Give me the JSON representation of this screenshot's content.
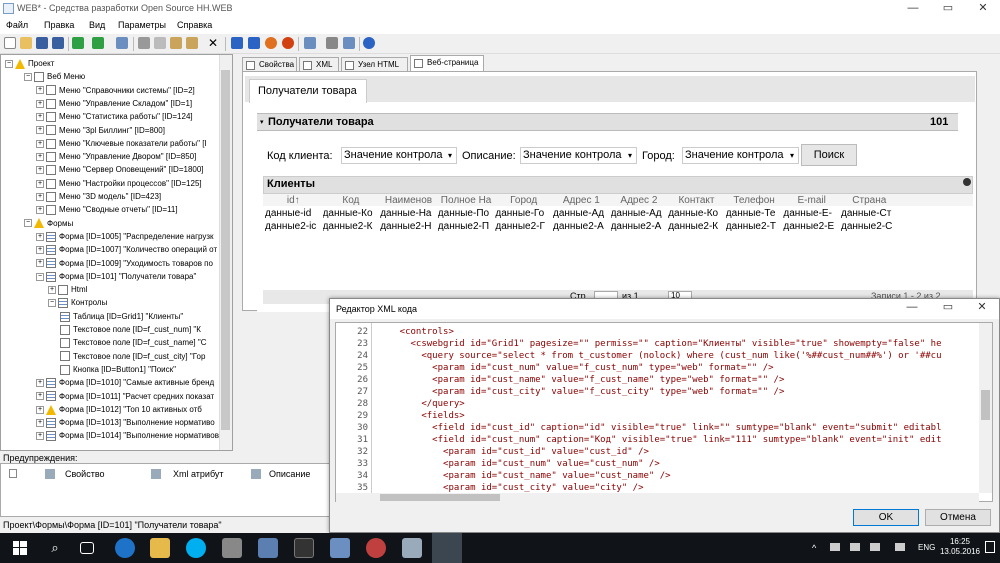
{
  "window": {
    "title": "WEB* - Средства разработки Open Source HH.WEB",
    "min": "—",
    "max": "▭",
    "close": "✕"
  },
  "menu": [
    "Файл",
    "Правка",
    "Вид",
    "Параметры",
    "Справка"
  ],
  "tree": [
    {
      "label": "Проект",
      "level": 0,
      "icon": "warn"
    },
    {
      "label": "Веб Меню",
      "level": 1,
      "icon": "folder"
    },
    {
      "label": "Меню \"Справочники системы\" [ID=2]",
      "level": 2,
      "icon": "menu"
    },
    {
      "label": "Меню \"Управление Складом\" [ID=1]",
      "level": 2,
      "icon": "menu"
    },
    {
      "label": "Меню \"Статистика работы\" [ID=124]",
      "level": 2,
      "icon": "menu"
    },
    {
      "label": "Меню \"3pl Биллинг\" [ID=800]",
      "level": 2,
      "icon": "menu"
    },
    {
      "label": "Меню \"Ключевые показатели работы\" [I",
      "level": 2,
      "icon": "menu"
    },
    {
      "label": "Меню \"Управление Двором\" [ID=850]",
      "level": 2,
      "icon": "menu"
    },
    {
      "label": "Меню \"Сервер Оповещений\" [ID=1800]",
      "level": 2,
      "icon": "menu"
    },
    {
      "label": "Меню \"Настройки процессов\" [ID=125]",
      "level": 2,
      "icon": "menu"
    },
    {
      "label": "Меню \"3D модель\" [ID=423]",
      "level": 2,
      "icon": "menu"
    },
    {
      "label": "Меню \"Сводные отчеты\" [ID=11]",
      "level": 2,
      "icon": "menu"
    },
    {
      "label": "Формы",
      "level": 1,
      "icon": "warn"
    },
    {
      "label": "Форма [ID=1005] \"Распределение нагрузк",
      "level": 2,
      "icon": "grid"
    },
    {
      "label": "Форма [ID=1007] \"Количество операций от",
      "level": 2,
      "icon": "grid"
    },
    {
      "label": "Форма [ID=1009] \"Уходимость товаров по",
      "level": 2,
      "icon": "grid"
    },
    {
      "label": "Форма [ID=101] \"Получатели товара\"",
      "level": 2,
      "icon": "grid"
    },
    {
      "label": "Html",
      "level": 3,
      "icon": "doc"
    },
    {
      "label": "Контролы",
      "level": 3,
      "icon": "grid"
    },
    {
      "label": "Таблица [ID=Grid1] \"Клиенты\"",
      "level": 4,
      "icon": "grid"
    },
    {
      "label": "Текстовое поле [ID=f_cust_num] \"К",
      "level": 4,
      "icon": "txt"
    },
    {
      "label": "Текстовое поле [ID=f_cust_name] \"С",
      "level": 4,
      "icon": "txt"
    },
    {
      "label": "Текстовое поле [ID=f_cust_city] \"Гор",
      "level": 4,
      "icon": "txt"
    },
    {
      "label": "Кнопка [ID=Button1] \"Поиск\"",
      "level": 4,
      "icon": "txt"
    },
    {
      "label": "Форма [ID=1010] \"Самые активные бренд",
      "level": 2,
      "icon": "grid"
    },
    {
      "label": "Форма [ID=1011] \"Расчет средних показат",
      "level": 2,
      "icon": "grid"
    },
    {
      "label": "Форма [ID=1012] \"Топ 10 активных отб",
      "level": 2,
      "icon": "warn"
    },
    {
      "label": "Форма [ID=1013] \"Выполнение нормативо",
      "level": 2,
      "icon": "grid"
    },
    {
      "label": "Форма [ID=1014] \"Выполнение нормативов",
      "level": 2,
      "icon": "grid"
    }
  ],
  "tabs": [
    "Свойства",
    "XML",
    "Узел HTML",
    "Веб-страница"
  ],
  "page_tab": "Получатели товара",
  "panel": {
    "title": "Получатели товара",
    "count": "101"
  },
  "filters": {
    "code_label": "Код клиента:",
    "code_value": "Значение контрола",
    "desc_label": "Описание:",
    "desc_value": "Значение контрола",
    "city_label": "Город:",
    "city_value": "Значение контрола",
    "search": "Поиск"
  },
  "grid": {
    "title": "Клиенты",
    "columns": [
      "id↑",
      "Код",
      "Наименов",
      "Полное На",
      "Город",
      "Адрес 1",
      "Адрес 2",
      "Контакт",
      "Телефон",
      "E-mail",
      "Страна"
    ],
    "rows": [
      [
        "данные-id",
        "данные-Ко",
        "данные-На",
        "данные-По",
        "данные-Го",
        "данные-Ад",
        "данные-Ад",
        "данные-Ко",
        "данные-Те",
        "данные-Е-",
        "данные-Ст"
      ],
      [
        "данные2-ic",
        "данные2-К",
        "данные2-Н",
        "данные2-П",
        "данные2-Г",
        "данные2-А",
        "данные2-А",
        "данные2-К",
        "данные2-Т",
        "данные2-Е",
        "данные2-С"
      ]
    ],
    "footer": {
      "page_label": "Стр.",
      "of_label": "из 1",
      "size": "10",
      "records": "Записи 1 - 2 из 2"
    }
  },
  "warnings": {
    "label": "Предупреждения:",
    "col_property": "Свойство",
    "col_xml": "Xml атрибут",
    "col_desc": "Описание"
  },
  "status": "Проект\\Формы\\Форма [ID=101] \"Получатели товара\"",
  "xml_dialog": {
    "title": "Редактор XML кода",
    "ok": "OK",
    "cancel": "Отмена",
    "lines": [
      {
        "n": "22",
        "code": "    <controls>"
      },
      {
        "n": "23",
        "code": "      <cswebgrid id=\"Grid1\" pagesize=\"\" permiss=\"\" caption=\"Клиенты\" visible=\"true\" showempty=\"false\" he"
      },
      {
        "n": "24",
        "code": "        <query source=\"select * from t_customer (nolock) where (cust_num like('%##cust_num##%') or '##cu"
      },
      {
        "n": "25",
        "code": "          <param id=\"cust_num\" value=\"f_cust_num\" type=\"web\" format=\"\" />"
      },
      {
        "n": "26",
        "code": "          <param id=\"cust_name\" value=\"f_cust_name\" type=\"web\" format=\"\" />"
      },
      {
        "n": "27",
        "code": "          <param id=\"cust_city\" value=\"f_cust_city\" type=\"web\" format=\"\" />"
      },
      {
        "n": "28",
        "code": "        </query>"
      },
      {
        "n": "29",
        "code": "        <fields>"
      },
      {
        "n": "30",
        "code": "          <field id=\"cust_id\" caption=\"id\" visible=\"true\" link=\"\" sumtype=\"blank\" event=\"submit\" editabl"
      },
      {
        "n": "31",
        "code": "          <field id=\"cust_num\" caption=\"Код\" visible=\"true\" link=\"111\" sumtype=\"blank\" event=\"init\" edit"
      },
      {
        "n": "32",
        "code": "            <param id=\"cust_id\" value=\"cust_id\" />"
      },
      {
        "n": "33",
        "code": "            <param id=\"cust_num\" value=\"cust_num\" />"
      },
      {
        "n": "34",
        "code": "            <param id=\"cust_name\" value=\"cust_name\" />"
      },
      {
        "n": "35",
        "code": "            <param id=\"cust_city\" value=\"city\" />"
      }
    ]
  },
  "taskbar": {
    "lang": "ENG",
    "time": "16:25",
    "date": "13.05.2016"
  }
}
